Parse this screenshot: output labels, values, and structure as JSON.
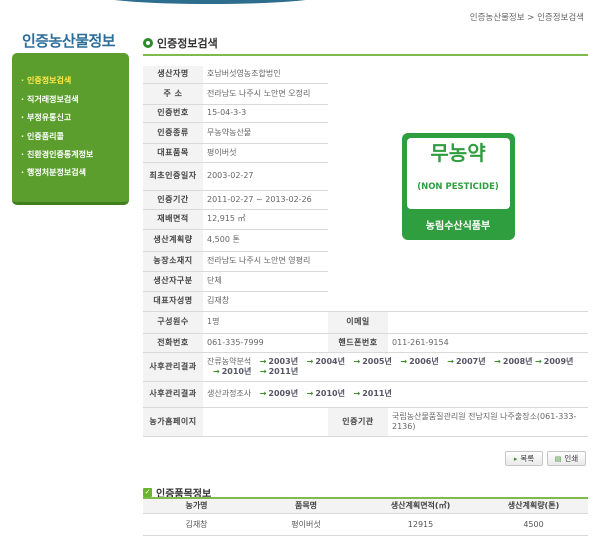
{
  "breadcrumb": {
    "home": "인증농산물정보",
    "sep": ">",
    "current": "인증정보검색"
  },
  "sidebar": {
    "title": "인증농산물정보",
    "items": [
      {
        "label": "인증정보검색",
        "active": true
      },
      {
        "label": "직거래정보검색"
      },
      {
        "label": "부정유통신고"
      },
      {
        "label": "인증품리콜"
      },
      {
        "label": "친환경인증통계정보"
      },
      {
        "label": "행정처분정보검색"
      }
    ]
  },
  "section_title": "인증정보검색",
  "info": {
    "producer_label": "생산자명",
    "producer": "호남버섯영농조합법인",
    "address_label": "주 소",
    "address": "전라남도 나주시 노안면 오정리",
    "cert_no_label": "인증번호",
    "cert_no": "15-04-3-3",
    "cert_type_label": "인증종류",
    "cert_type": "무농약농산물",
    "item_label": "대표품목",
    "item": "평이버섯",
    "first_date_label": "최초인증일자",
    "first_date": "2003-02-27",
    "period_label": "인증기간",
    "period": "2011-02-27 ~ 2013-02-26",
    "area_label": "재배면적",
    "area": "12,915 ㎡",
    "plan_label": "생산계획량",
    "plan": "4,500 톤",
    "farm_loc_label": "농장소재지",
    "farm_loc": "전라남도 나주시 노안면 영평리",
    "producer_type_label": "생산자구분",
    "producer_type": "단체",
    "rep_label": "대표자성명",
    "rep": "김재창",
    "members_label": "구성원수",
    "members": "1명",
    "email_label": "이메일",
    "email": "",
    "phone_label": "전화번호",
    "phone": "061-335-7999",
    "mobile_label": "핸드폰번호",
    "mobile": "011-261-9154",
    "post_cert_label": "사후관리결과",
    "post_cert_type": "잔류농약분석",
    "post_cert_years": [
      "2003년",
      "2004년",
      "2005년",
      "2006년",
      "2007년",
      "2008년",
      "2009년",
      "2010년",
      "2011년"
    ],
    "post_survey_label": "사후관리결과",
    "post_survey_type": "생산과정조사",
    "post_survey_years": [
      "2009년",
      "2010년",
      "2011년"
    ],
    "homepage_label": "농가홈페이지",
    "homepage": "",
    "agency_label": "인증기관",
    "agency": "국립농산물품질관리원 전남지원 나주출장소(061-333-2136)"
  },
  "logo": {
    "main": "무농약",
    "sub": "(NON PESTICIDE)",
    "foot": "농림수산식품부",
    "color": "#2f9e3f"
  },
  "buttons": {
    "list": "목록",
    "print": "인쇄"
  },
  "product": {
    "title": "인증품목정보",
    "headers": [
      "농가명",
      "품목명",
      "생산계획면적(㎡)",
      "생산계획량(톤)"
    ],
    "rows": [
      [
        "김재창",
        "평이버섯",
        "12915",
        "4500"
      ]
    ]
  }
}
